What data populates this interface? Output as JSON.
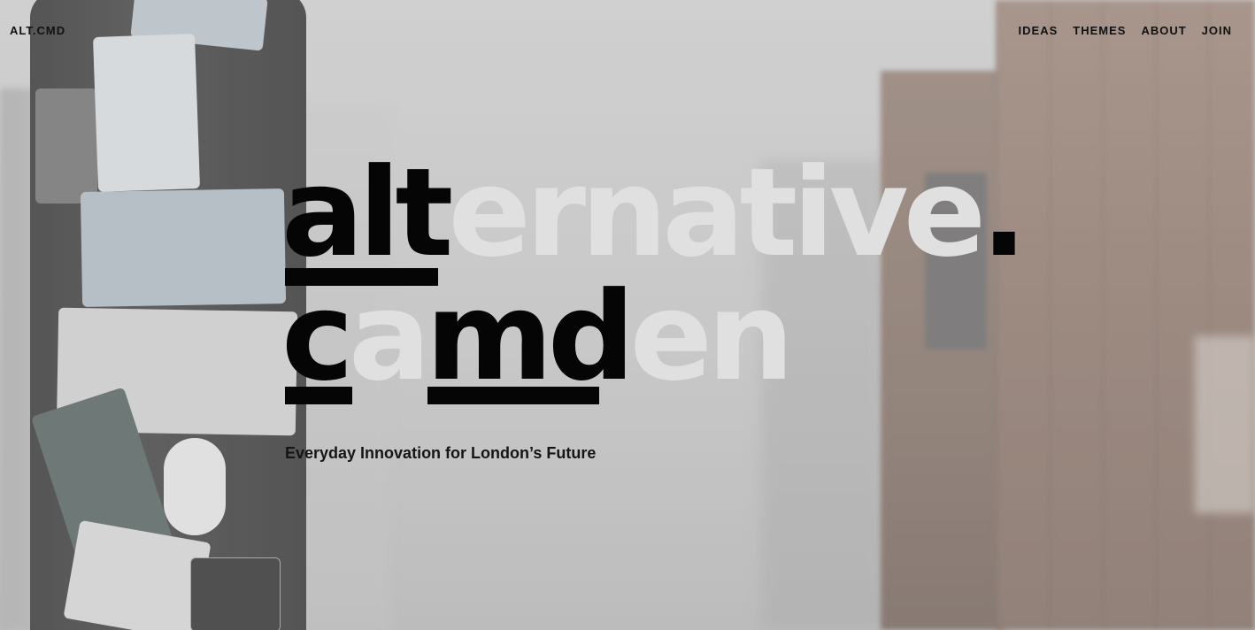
{
  "header": {
    "logo": "ALT.CMD",
    "nav": [
      {
        "label": "IDEAS"
      },
      {
        "label": "THEMES"
      },
      {
        "label": "ABOUT"
      },
      {
        "label": "JOIN"
      }
    ]
  },
  "hero": {
    "line1": {
      "bold": "alt",
      "faded": "ernative",
      "period": "."
    },
    "line2": {
      "c": "c",
      "a": "a",
      "md": "md",
      "en": "en"
    },
    "tagline": "Everyday Innovation for London’s Future"
  },
  "colors": {
    "text_dark": "#050505",
    "text_faded": "#e0e0e0"
  }
}
